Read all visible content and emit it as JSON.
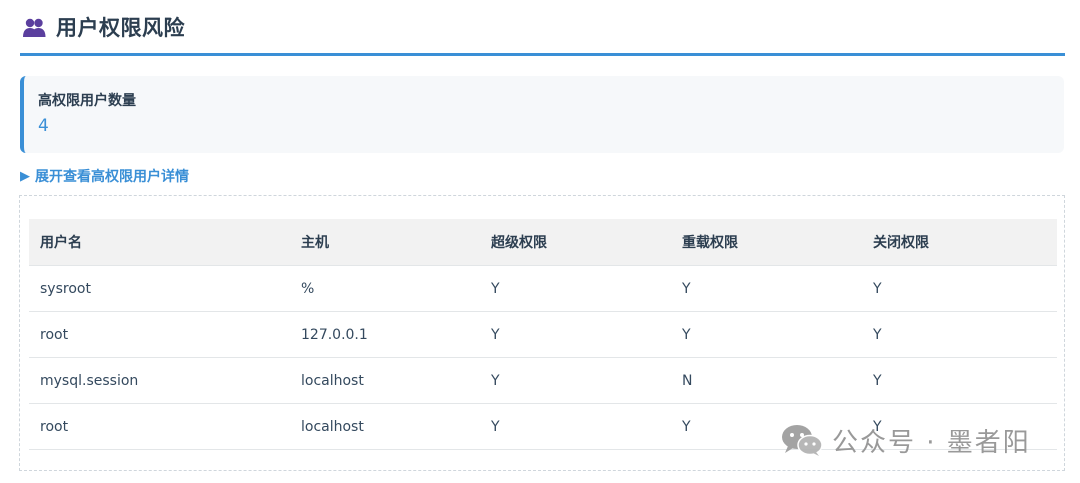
{
  "section": {
    "icon": "users-icon",
    "title": "用户权限风险"
  },
  "metric": {
    "label": "高权限用户数量",
    "value": "4"
  },
  "details": {
    "toggle_arrow": "▶",
    "toggle_label": "展开查看高权限用户详情"
  },
  "table": {
    "headers": [
      "用户名",
      "主机",
      "超级权限",
      "重载权限",
      "关闭权限"
    ],
    "rows": [
      [
        "sysroot",
        "%",
        "Y",
        "Y",
        "Y"
      ],
      [
        "root",
        "127.0.0.1",
        "Y",
        "Y",
        "Y"
      ],
      [
        "mysql.session",
        "localhost",
        "Y",
        "N",
        "Y"
      ],
      [
        "root",
        "localhost",
        "Y",
        "Y",
        "Y"
      ]
    ]
  },
  "watermark": {
    "icon": "wechat-icon",
    "text": "公众号 · 墨者阳"
  },
  "colors": {
    "accent": "#3a8fd6",
    "title_text": "#2c3e50",
    "card_bg": "#f6f8fa",
    "header_bg": "#f2f2f2",
    "icon_purple": "#5b3f9e"
  }
}
